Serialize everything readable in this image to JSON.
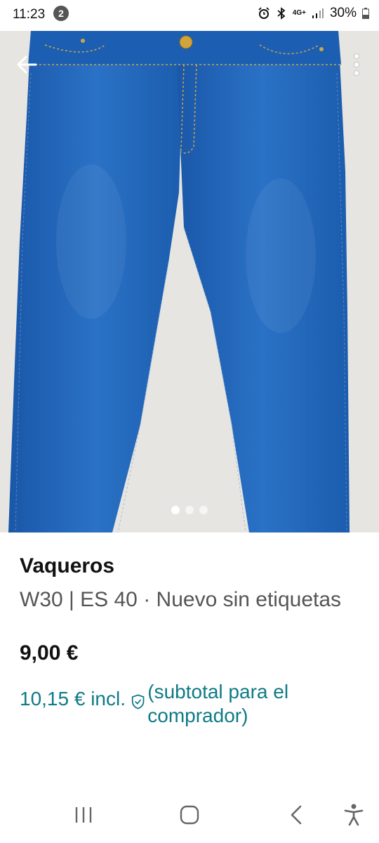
{
  "status_bar": {
    "time": "11:23",
    "notification_count": "2",
    "network": "4G+",
    "battery": "30%"
  },
  "listing": {
    "image_count": 3,
    "active_image": 1,
    "title": "Vaqueros",
    "subtitle": "W30 | ES 40 · Nuevo sin etiquetas",
    "price": "9,00 €",
    "price_incl": "10,15 € incl.",
    "subtotal_note": "(subtotal para el comprador)"
  },
  "colors": {
    "accent": "#0f7a86",
    "denim": "#1f63b8",
    "background": "#e8e7e3"
  },
  "icons": {
    "back": "back-arrow-icon",
    "more": "more-vertical-icon",
    "shield": "shield-check-icon",
    "nav_recent": "recent-apps-icon",
    "nav_home": "home-icon",
    "nav_back": "nav-back-icon",
    "accessibility": "accessibility-icon"
  }
}
